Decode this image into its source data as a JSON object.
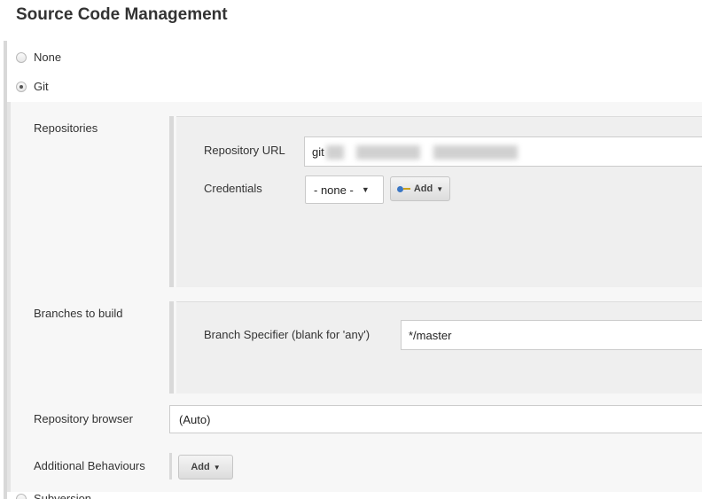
{
  "title": "Source Code Management",
  "scm_options": [
    {
      "label": "None",
      "checked": false
    },
    {
      "label": "Git",
      "checked": true
    },
    {
      "label": "Subversion",
      "checked": false
    }
  ],
  "repositories": {
    "label": "Repositories",
    "url_label": "Repository URL",
    "url_value": "git",
    "credentials_label": "Credentials",
    "credentials_value": "- none -",
    "add_button": "Add"
  },
  "branches": {
    "label": "Branches to build",
    "specifier_label": "Branch Specifier (blank for 'any')",
    "specifier_value": "*/master"
  },
  "repo_browser": {
    "label": "Repository browser",
    "value": "(Auto)"
  },
  "behaviours": {
    "label": "Additional Behaviours",
    "add_button": "Add"
  }
}
